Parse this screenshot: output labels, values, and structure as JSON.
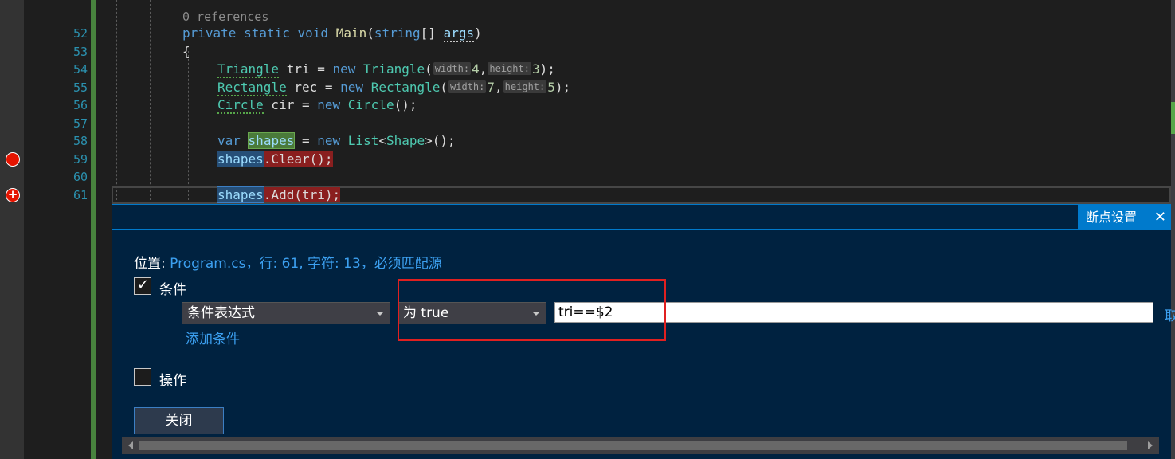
{
  "editor": {
    "line_numbers": [
      "52",
      "53",
      "54",
      "55",
      "56",
      "57",
      "58",
      "59",
      "60",
      "61"
    ],
    "codelens": "0 references",
    "breakpoint_color": "#e51400",
    "lines": {
      "l52": {
        "kw1": "private",
        "kw2": "static",
        "kw3": "void",
        "method": "Main",
        "open": "(",
        "type": "string",
        "rest": "[] ",
        "param": "args",
        "close": ")"
      },
      "l53": {
        "brace": "{"
      },
      "l54": {
        "type": "Triangle",
        "mid": " tri = ",
        "kw": "new",
        "ctor": "Triangle",
        "open": "(",
        "hint1": "width:",
        "val1": "4",
        "comma": ",",
        "hint2": "height:",
        "val2": "3",
        "close": ");"
      },
      "l55": {
        "type": "Rectangle",
        "mid": " rec = ",
        "kw": "new",
        "ctor": "Rectangle",
        "open": "(",
        "hint1": "width:",
        "val1": "7",
        "comma": ",",
        "hint2": "height:",
        "val2": "5",
        "close": ");"
      },
      "l56": {
        "type": "Circle",
        "mid": " cir = ",
        "kw": "new",
        "ctor": "Circle",
        "close": "();"
      },
      "l58": {
        "kw": "var",
        "var": "shapes",
        "eq": " = ",
        "kw2": "new",
        "type": "List",
        "lt": "<",
        "type2": "Shape",
        "close": ">();"
      },
      "l59": {
        "obj": "shapes",
        "call": ".Clear();"
      },
      "l61": {
        "obj": "shapes",
        "call": ".Add(tri);"
      }
    }
  },
  "panel": {
    "tab_title": "断点设置",
    "close_glyph": "✕",
    "location_label": "位置: ",
    "location_link": "Program.cs，行: 61, 字符: 13，必须匹配源",
    "conditions_label": "条件",
    "conditions_checked": true,
    "condition_type": "条件表达式",
    "condition_mode": "为 true",
    "condition_expression": "tri==$2",
    "add_condition": "添加条件",
    "actions_label": "操作",
    "actions_checked": false,
    "close_button": "关闭",
    "edge_text": "取"
  },
  "colors": {
    "panel_bg": "#002240",
    "accent": "#007acc",
    "link": "#3ca0f0",
    "highlight_box": "#e02020"
  }
}
